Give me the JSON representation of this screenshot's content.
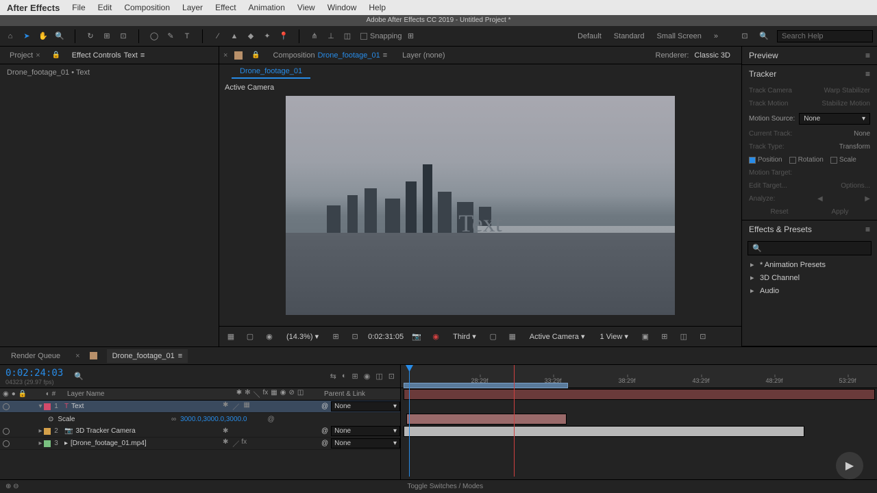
{
  "menu": {
    "app": "After Effects",
    "items": [
      "File",
      "Edit",
      "Composition",
      "Layer",
      "Effect",
      "Animation",
      "View",
      "Window",
      "Help"
    ]
  },
  "title": "Adobe After Effects CC 2019 - Untitled Project *",
  "toolbar": {
    "snapping": "Snapping"
  },
  "workspaces": [
    "Default",
    "Standard",
    "Small Screen"
  ],
  "search": {
    "placeholder": "Search Help"
  },
  "left": {
    "tab_project": "Project",
    "tab_effect": "Effect Controls",
    "tab_effect_target": "Text",
    "path": "Drone_footage_01 • Text"
  },
  "comp": {
    "tab_label": "Composition",
    "tab_name": "Drone_footage_01",
    "tab_layer": "Layer (none)",
    "subtab": "Drone_footage_01",
    "renderer_label": "Renderer:",
    "renderer_value": "Classic 3D",
    "active_camera": "Active Camera",
    "text_layer": "Text"
  },
  "viewer_controls": {
    "zoom": "(14.3%)",
    "timecode": "0:02:31:05",
    "res": "Third",
    "camera": "Active Camera",
    "views": "1 View"
  },
  "preview": {
    "title": "Preview"
  },
  "tracker": {
    "title": "Tracker",
    "track_camera": "Track Camera",
    "warp": "Warp Stabilizer",
    "track_motion": "Track Motion",
    "stabilize": "Stabilize Motion",
    "motion_source": "Motion Source:",
    "motion_source_val": "None",
    "current_track": "Current Track:",
    "current_track_val": "None",
    "track_type": "Track Type:",
    "track_type_val": "Transform",
    "position": "Position",
    "rotation": "Rotation",
    "scale": "Scale",
    "motion_target": "Motion Target:",
    "edit_target": "Edit Target...",
    "options": "Options...",
    "analyze": "Analyze:",
    "reset": "Reset",
    "apply": "Apply"
  },
  "effects_presets": {
    "title": "Effects & Presets",
    "items": [
      "* Animation Presets",
      "3D Channel",
      "Audio"
    ]
  },
  "timeline": {
    "tab_render": "Render Queue",
    "tab_comp": "Drone_footage_01",
    "timecode": "0:02:24:03",
    "timecode_sub": "04323 (29.97 fps)",
    "col_layer": "Layer Name",
    "col_parent": "Parent & Link",
    "layers": [
      {
        "num": "1",
        "name": "Text",
        "type": "T",
        "color": "#d44a6a",
        "parent": "None",
        "selected": true
      },
      {
        "num": "2",
        "name": "3D Tracker Camera",
        "type": "cam",
        "color": "#d4a04a",
        "parent": "None"
      },
      {
        "num": "3",
        "name": "[Drone_footage_01.mp4]",
        "type": "vid",
        "color": "#7ac080",
        "parent": "None"
      }
    ],
    "prop_scale": "Scale",
    "scale_val": "3000.0,3000.0,3000.0",
    "ruler": [
      "28:29f",
      "33:29f",
      "38:29f",
      "43:29f",
      "48:29f",
      "53:29f"
    ],
    "toggle": "Toggle Switches / Modes"
  }
}
